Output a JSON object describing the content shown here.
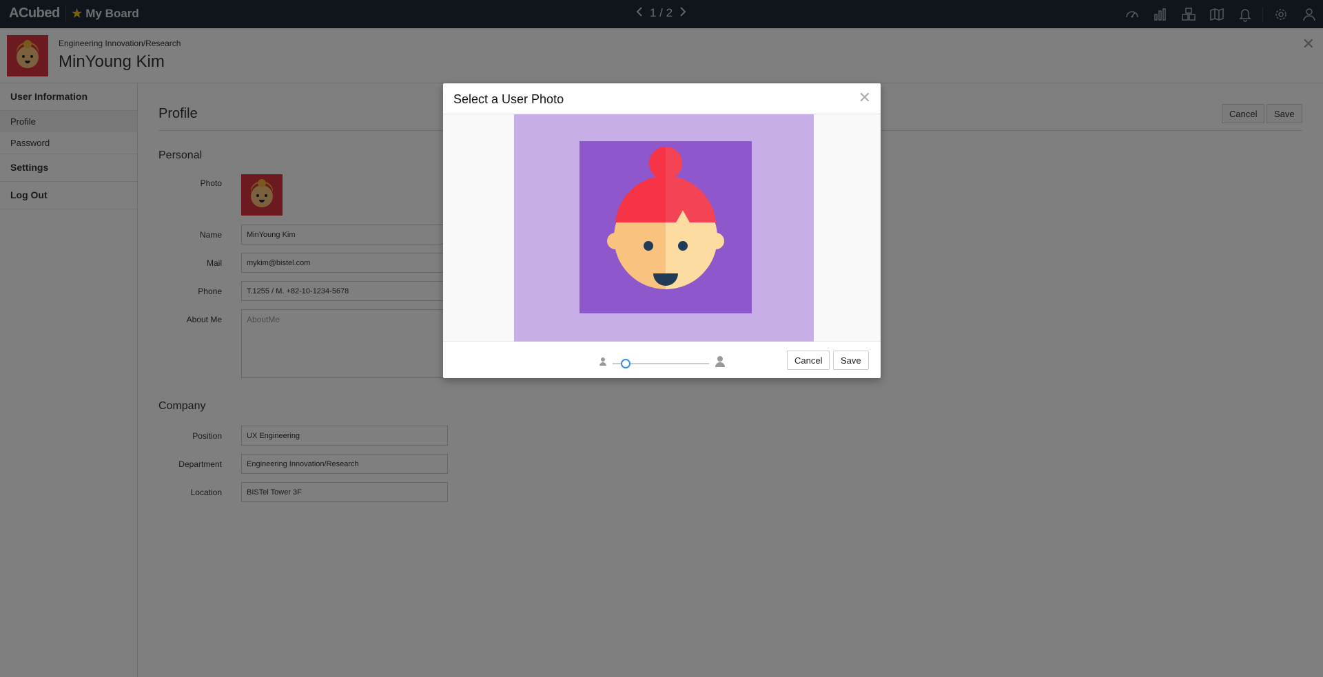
{
  "topbar": {
    "brand": "ACubed",
    "board_label": "My Board",
    "pager": "1 / 2",
    "icons": [
      "dashboard-icon",
      "chart-icon",
      "modules-icon",
      "map-icon",
      "bell-icon",
      "gear-icon",
      "user-icon"
    ]
  },
  "header": {
    "department": "Engineering Innovation/Research",
    "name": "MinYoung Kim"
  },
  "sidebar": {
    "groups": [
      {
        "label": "User Information",
        "items": [
          {
            "label": "Profile",
            "active": true
          },
          {
            "label": "Password",
            "active": false
          }
        ]
      },
      {
        "label": "Settings",
        "items": []
      },
      {
        "label": "Log Out",
        "items": []
      }
    ]
  },
  "main": {
    "title": "Profile",
    "cancel_label": "Cancel",
    "save_label": "Save",
    "personal": {
      "heading": "Personal",
      "photo_label": "Photo",
      "name_label": "Name",
      "name_value": "MinYoung Kim",
      "mail_label": "Mail",
      "mail_value": "mykim@bistel.com",
      "phone_label": "Phone",
      "phone_value": "T.1255 / M. +82-10-1234-5678",
      "about_label": "About Me",
      "about_placeholder": "AboutMe"
    },
    "company": {
      "heading": "Company",
      "position_label": "Position",
      "position_value": "UX Engineering",
      "department_label": "Department",
      "department_value": "Engineering Innovation/Research",
      "location_label": "Location",
      "location_value": "BISTel Tower 3F"
    }
  },
  "modal": {
    "title": "Select a User Photo",
    "zoom_level": 0.1,
    "cancel_label": "Cancel",
    "save_label": "Save"
  },
  "colors": {
    "topbar": "#1f2a37",
    "avatar_bg": "#d9333f",
    "crop_bg": "#c8aee6",
    "crop_box": "#8e57cc",
    "hair": "#f73446",
    "skin": "#f9c37f",
    "skin_light": "#fcdca0",
    "slider_accent": "#3a8ee6"
  }
}
